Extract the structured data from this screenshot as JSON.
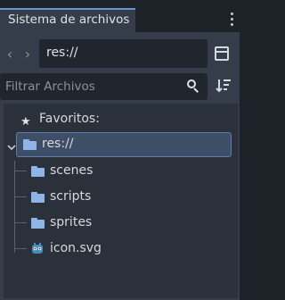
{
  "dock": {
    "tab_title": "Sistema de archivos"
  },
  "toolbar": {
    "back_icon": "chevron-left-icon",
    "forward_icon": "chevron-right-icon",
    "path": "res://",
    "split_icon": "split-view-icon"
  },
  "filter": {
    "placeholder": "Filtrar Archivos",
    "search_icon": "search-icon",
    "sort_icon": "sort-icon"
  },
  "tree": {
    "favorites": "Favoritos:",
    "root": "res://",
    "children": [
      {
        "label": "scenes",
        "icon": "folder-icon"
      },
      {
        "label": "scripts",
        "icon": "folder-icon"
      },
      {
        "label": "sprites",
        "icon": "folder-icon"
      },
      {
        "label": "icon.svg",
        "icon": "godot-icon"
      }
    ]
  },
  "colors": {
    "accent": "#6997d5",
    "folder": "#8fb4e6",
    "panel": "#363d4a",
    "tree_bg": "#2b313a",
    "selection": "#3e4e66"
  }
}
